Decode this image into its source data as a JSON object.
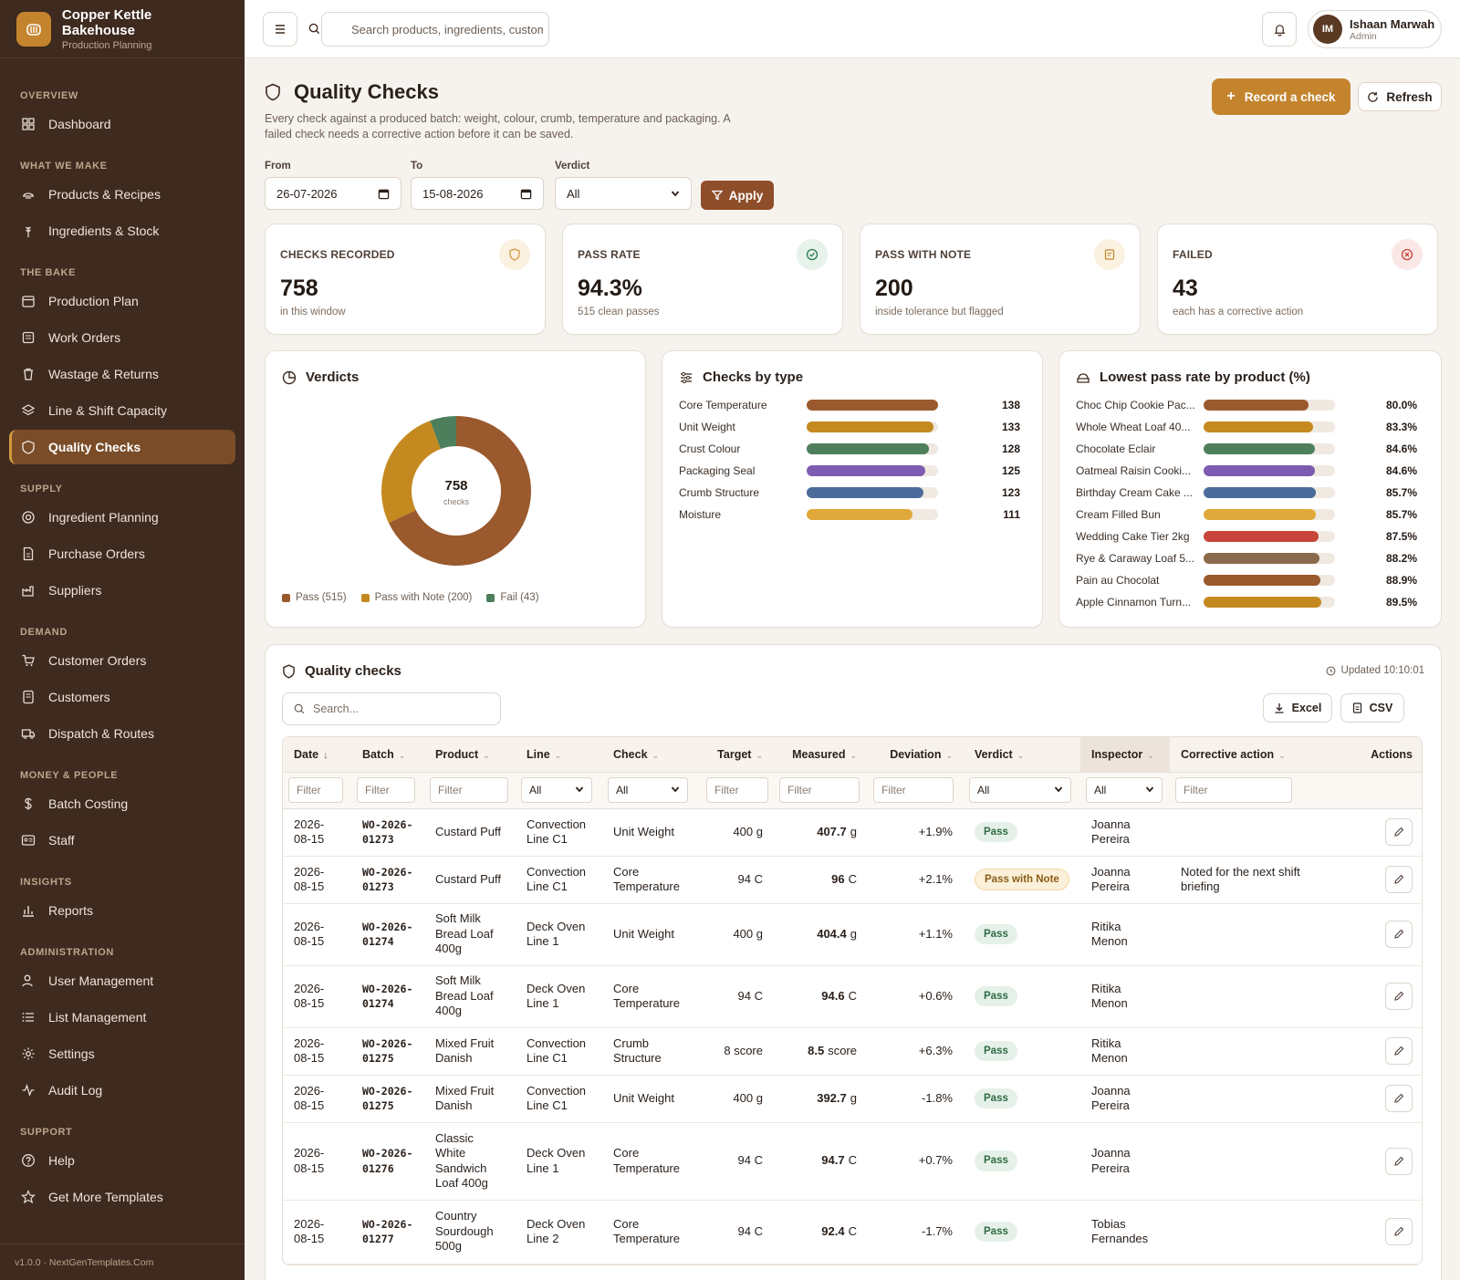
{
  "brand": {
    "name": "Copper Kettle Bakehouse",
    "subtitle": "Production Planning"
  },
  "sidebar": {
    "sections": [
      {
        "label": "OVERVIEW",
        "items": [
          {
            "label": "Dashboard",
            "icon": "dashboard-icon"
          }
        ]
      },
      {
        "label": "WHAT WE MAKE",
        "items": [
          {
            "label": "Products & Recipes",
            "icon": "recipe-icon"
          },
          {
            "label": "Ingredients & Stock",
            "icon": "wheat-icon"
          }
        ]
      },
      {
        "label": "THE BAKE",
        "items": [
          {
            "label": "Production Plan",
            "icon": "calendar-icon"
          },
          {
            "label": "Work Orders",
            "icon": "clipboard-icon"
          },
          {
            "label": "Wastage & Returns",
            "icon": "trash-icon"
          },
          {
            "label": "Line & Shift Capacity",
            "icon": "layers-icon"
          },
          {
            "label": "Quality Checks",
            "icon": "shield-icon",
            "active": true
          }
        ]
      },
      {
        "label": "SUPPLY",
        "items": [
          {
            "label": "Ingredient Planning",
            "icon": "target-icon"
          },
          {
            "label": "Purchase Orders",
            "icon": "document-icon"
          },
          {
            "label": "Suppliers",
            "icon": "factory-icon"
          }
        ]
      },
      {
        "label": "DEMAND",
        "items": [
          {
            "label": "Customer Orders",
            "icon": "cart-icon"
          },
          {
            "label": "Customers",
            "icon": "contacts-icon"
          },
          {
            "label": "Dispatch & Routes",
            "icon": "truck-icon"
          }
        ]
      },
      {
        "label": "MONEY & PEOPLE",
        "items": [
          {
            "label": "Batch Costing",
            "icon": "dollar-icon"
          },
          {
            "label": "Staff",
            "icon": "id-card-icon"
          }
        ]
      },
      {
        "label": "INSIGHTS",
        "items": [
          {
            "label": "Reports",
            "icon": "bar-chart-icon"
          }
        ]
      },
      {
        "label": "ADMINISTRATION",
        "items": [
          {
            "label": "User Management",
            "icon": "user-icon"
          },
          {
            "label": "List Management",
            "icon": "list-icon"
          },
          {
            "label": "Settings",
            "icon": "gear-icon"
          },
          {
            "label": "Audit Log",
            "icon": "activity-icon"
          }
        ]
      },
      {
        "label": "SUPPORT",
        "items": [
          {
            "label": "Help",
            "icon": "help-icon"
          },
          {
            "label": "Get More Templates",
            "icon": "star-icon"
          }
        ]
      }
    ],
    "footer": "v1.0.0 · NextGenTemplates.Com"
  },
  "topbar": {
    "search_placeholder": "Search products, ingredients, customers",
    "user": {
      "initials": "IM",
      "name": "Ishaan Marwah",
      "role": "Admin"
    }
  },
  "page": {
    "title": "Quality Checks",
    "description": "Every check against a produced batch: weight, colour, crumb, temperature and packaging. A failed check needs a corrective action before it can be saved.",
    "record_label": "Record a check",
    "refresh_label": "Refresh"
  },
  "filters": {
    "from_label": "From",
    "from_value": "26-07-2026",
    "to_label": "To",
    "to_value": "15-08-2026",
    "verdict_label": "Verdict",
    "verdict_value": "All",
    "apply_label": "Apply"
  },
  "kpis": [
    {
      "label": "CHECKS RECORDED",
      "value": "758",
      "sub": "in this window",
      "icon": "shield-icon",
      "color": "#d59a3f",
      "bg": "#fbf1e1"
    },
    {
      "label": "PASS RATE",
      "value": "94.3%",
      "sub": "515 clean passes",
      "icon": "check-circle-icon",
      "color": "#2f7a52",
      "bg": "#e6f2ea"
    },
    {
      "label": "PASS WITH NOTE",
      "value": "200",
      "sub": "inside tolerance but flagged",
      "icon": "note-icon",
      "color": "#c48a2e",
      "bg": "#fbf1e1"
    },
    {
      "label": "FAILED",
      "value": "43",
      "sub": "each has a corrective action",
      "icon": "x-circle-icon",
      "color": "#c8453a",
      "bg": "#fbe8e6"
    }
  ],
  "verdicts": {
    "title": "Verdicts",
    "center_value": "758",
    "center_label": "checks",
    "chart_data": {
      "type": "pie",
      "categories": [
        "Pass",
        "Pass with Note",
        "Fail"
      ],
      "values": [
        515,
        200,
        43
      ],
      "colors": [
        "#9a5a2e",
        "#c48a20",
        "#4e7f5c"
      ],
      "legend": [
        "Pass (515)",
        "Pass with Note (200)",
        "Fail (43)"
      ]
    }
  },
  "checks_by_type": {
    "title": "Checks by type",
    "chart_data": {
      "type": "bar",
      "categories": [
        "Core Temperature",
        "Unit Weight",
        "Crust Colour",
        "Packaging Seal",
        "Crumb Structure",
        "Moisture"
      ],
      "values": [
        138,
        133,
        128,
        125,
        123,
        111
      ],
      "colors": [
        "#9a5a2e",
        "#c48a20",
        "#4e7f5c",
        "#7d5bb0",
        "#4b6c9a",
        "#e0a93a"
      ],
      "xlim": [
        0,
        138
      ]
    }
  },
  "lowest_pass": {
    "title": "Lowest pass rate by product (%)",
    "chart_data": {
      "type": "bar",
      "categories": [
        "Choc Chip Cookie Pac...",
        "Whole Wheat Loaf 40...",
        "Chocolate Eclair",
        "Oatmeal Raisin Cooki...",
        "Birthday Cream Cake ...",
        "Cream Filled Bun",
        "Wedding Cake Tier 2kg",
        "Rye & Caraway Loaf 5...",
        "Pain au Chocolat",
        "Apple Cinnamon Turn..."
      ],
      "values": [
        80.0,
        83.3,
        84.6,
        84.6,
        85.7,
        85.7,
        87.5,
        88.2,
        88.9,
        89.5
      ],
      "labels": [
        "80.0%",
        "83.3%",
        "84.6%",
        "84.6%",
        "85.7%",
        "85.7%",
        "87.5%",
        "88.2%",
        "88.9%",
        "89.5%"
      ],
      "colors": [
        "#9a5a2e",
        "#c48a20",
        "#4e7f5c",
        "#7d5bb0",
        "#4b6c9a",
        "#e0a93a",
        "#c8453a",
        "#8a6a4a",
        "#9a5a2e",
        "#c48a20"
      ],
      "xlim": [
        0,
        100
      ]
    }
  },
  "table": {
    "title": "Quality checks",
    "updated": "Updated 10:10:01",
    "search_placeholder": "Search...",
    "excel_label": "Excel",
    "csv_label": "CSV",
    "columns": [
      "Date",
      "Batch",
      "Product",
      "Line",
      "Check",
      "Target",
      "Measured",
      "Deviation",
      "Verdict",
      "Inspector",
      "Corrective action",
      "Actions"
    ],
    "filter_placeholder": "Filter",
    "filter_all": "All",
    "rows": [
      {
        "date": "2026-08-15",
        "batch": "WO-2026-01273",
        "product": "Custard Puff",
        "line": "Convection Line C1",
        "check": "Unit Weight",
        "target": "400 g",
        "measured": "407.7",
        "unit": "g",
        "deviation": "+1.9%",
        "verdict": "Pass",
        "inspector": "Joanna Pereira",
        "action": ""
      },
      {
        "date": "2026-08-15",
        "batch": "WO-2026-01273",
        "product": "Custard Puff",
        "line": "Convection Line C1",
        "check": "Core Temperature",
        "target": "94 C",
        "measured": "96",
        "unit": "C",
        "deviation": "+2.1%",
        "verdict": "Pass with Note",
        "inspector": "Joanna Pereira",
        "action": "Noted for the next shift briefing"
      },
      {
        "date": "2026-08-15",
        "batch": "WO-2026-01274",
        "product": "Soft Milk Bread Loaf 400g",
        "line": "Deck Oven Line 1",
        "check": "Unit Weight",
        "target": "400 g",
        "measured": "404.4",
        "unit": "g",
        "deviation": "+1.1%",
        "verdict": "Pass",
        "inspector": "Ritika Menon",
        "action": ""
      },
      {
        "date": "2026-08-15",
        "batch": "WO-2026-01274",
        "product": "Soft Milk Bread Loaf 400g",
        "line": "Deck Oven Line 1",
        "check": "Core Temperature",
        "target": "94 C",
        "measured": "94.6",
        "unit": "C",
        "deviation": "+0.6%",
        "verdict": "Pass",
        "inspector": "Ritika Menon",
        "action": ""
      },
      {
        "date": "2026-08-15",
        "batch": "WO-2026-01275",
        "product": "Mixed Fruit Danish",
        "line": "Convection Line C1",
        "check": "Crumb Structure",
        "target": "8 score",
        "measured": "8.5",
        "unit": "score",
        "deviation": "+6.3%",
        "verdict": "Pass",
        "inspector": "Ritika Menon",
        "action": ""
      },
      {
        "date": "2026-08-15",
        "batch": "WO-2026-01275",
        "product": "Mixed Fruit Danish",
        "line": "Convection Line C1",
        "check": "Unit Weight",
        "target": "400 g",
        "measured": "392.7",
        "unit": "g",
        "deviation": "-1.8%",
        "verdict": "Pass",
        "inspector": "Joanna Pereira",
        "action": ""
      },
      {
        "date": "2026-08-15",
        "batch": "WO-2026-01276",
        "product": "Classic White Sandwich Loaf 400g",
        "line": "Deck Oven Line 1",
        "check": "Core Temperature",
        "target": "94 C",
        "measured": "94.7",
        "unit": "C",
        "deviation": "+0.7%",
        "verdict": "Pass",
        "inspector": "Joanna Pereira",
        "action": ""
      },
      {
        "date": "2026-08-15",
        "batch": "WO-2026-01277",
        "product": "Country Sourdough 500g",
        "line": "Deck Oven Line 2",
        "check": "Core Temperature",
        "target": "94 C",
        "measured": "92.4",
        "unit": "C",
        "deviation": "-1.7%",
        "verdict": "Pass",
        "inspector": "Tobias Fernandes",
        "action": ""
      }
    ]
  }
}
